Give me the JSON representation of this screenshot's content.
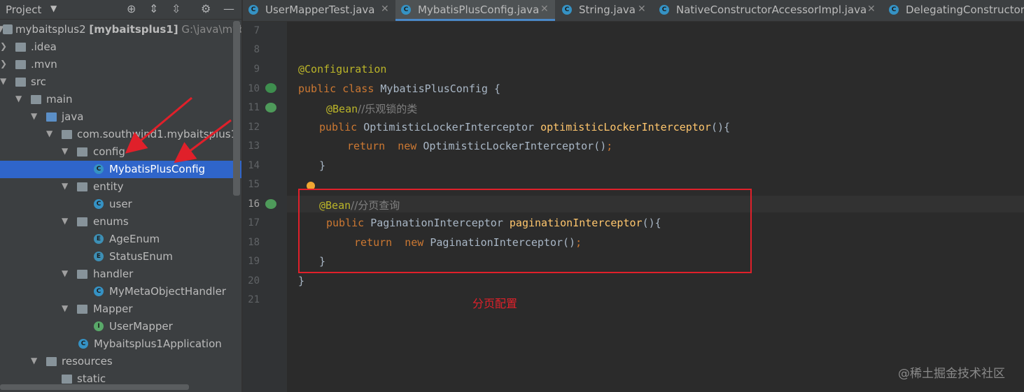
{
  "project_panel": {
    "title": "Project",
    "tree": [
      {
        "label": "mybaitsplus2",
        "bold": "[mybaitsplus1]",
        "hint": "G:\\java\\mybait",
        "icon": "module-icon"
      },
      {
        "label": ".idea",
        "icon": "folder-icon"
      },
      {
        "label": ".mvn",
        "icon": "folder-icon"
      },
      {
        "label": "src",
        "icon": "folder-icon"
      },
      {
        "label": "main",
        "icon": "folder-icon"
      },
      {
        "label": "java",
        "icon": "source-folder-icon"
      },
      {
        "label": "com.southwind1.mybaitsplus1",
        "icon": "package-icon"
      },
      {
        "label": "config",
        "icon": "package-icon"
      },
      {
        "label": "MybatisPlusConfig",
        "icon": "class-icon",
        "selected": true
      },
      {
        "label": "entity",
        "icon": "package-icon"
      },
      {
        "label": "user",
        "icon": "class-icon"
      },
      {
        "label": "enums",
        "icon": "package-icon"
      },
      {
        "label": "AgeEnum",
        "icon": "enum-icon"
      },
      {
        "label": "StatusEnum",
        "icon": "enum-icon"
      },
      {
        "label": "handler",
        "icon": "package-icon"
      },
      {
        "label": "MyMetaObjectHandler",
        "icon": "class-icon"
      },
      {
        "label": "Mapper",
        "icon": "package-icon"
      },
      {
        "label": "UserMapper",
        "icon": "interface-icon"
      },
      {
        "label": "Mybaitsplus1Application",
        "icon": "spring-boot-class-icon"
      },
      {
        "label": "resources",
        "icon": "resources-folder-icon"
      },
      {
        "label": "static",
        "icon": "folder-icon"
      }
    ]
  },
  "tabs": [
    {
      "label": "UserMapperTest.java",
      "active": false
    },
    {
      "label": "MybatisPlusConfig.java",
      "active": true
    },
    {
      "label": "String.java",
      "active": false
    },
    {
      "label": "NativeConstructorAccessorImpl.java",
      "active": false
    },
    {
      "label": "DelegatingConstructor",
      "active": false
    }
  ],
  "editor": {
    "line_numbers": [
      "7",
      "8",
      "9",
      "10",
      "11",
      "12",
      "13",
      "14",
      "15",
      "16",
      "17",
      "18",
      "19",
      "20",
      "21"
    ],
    "code": {
      "l9_ann": "@Configuration",
      "l10_kw": "public class ",
      "l10_rest": "MybatisPlusConfig {",
      "l11_ann": "@Bean",
      "l11_cm": "//乐观锁的类",
      "l12_kw": "public ",
      "l12_type": "OptimisticLockerInterceptor ",
      "l12_fn": "optimisticLockerInterceptor",
      "l12_rest": "(){",
      "l13_kw1": "return  ",
      "l13_kw2": "new ",
      "l13_rest": "OptimisticLockerInterceptor()",
      "l13_semi": ";",
      "l14": "}",
      "l16_ann": "@Bean",
      "l16_cm": "//分页查询",
      "l17_kw": "public ",
      "l17_type": "PaginationInterceptor ",
      "l17_fn": "paginationInterceptor",
      "l17_rest": "(){",
      "l18_kw1": "return  ",
      "l18_kw2": "new ",
      "l18_rest": "PaginationInterceptor()",
      "l18_semi": ";",
      "l19": "}",
      "l20": "}"
    }
  },
  "annotation_note": "分页配置",
  "watermark": "@稀土掘金技术社区",
  "colors": {
    "keyword": "#cc7832",
    "annotation": "#bbb529",
    "method": "#ffc66d",
    "comment": "#808080",
    "highlight_red": "#e0202a",
    "selection": "#2f65ca"
  }
}
